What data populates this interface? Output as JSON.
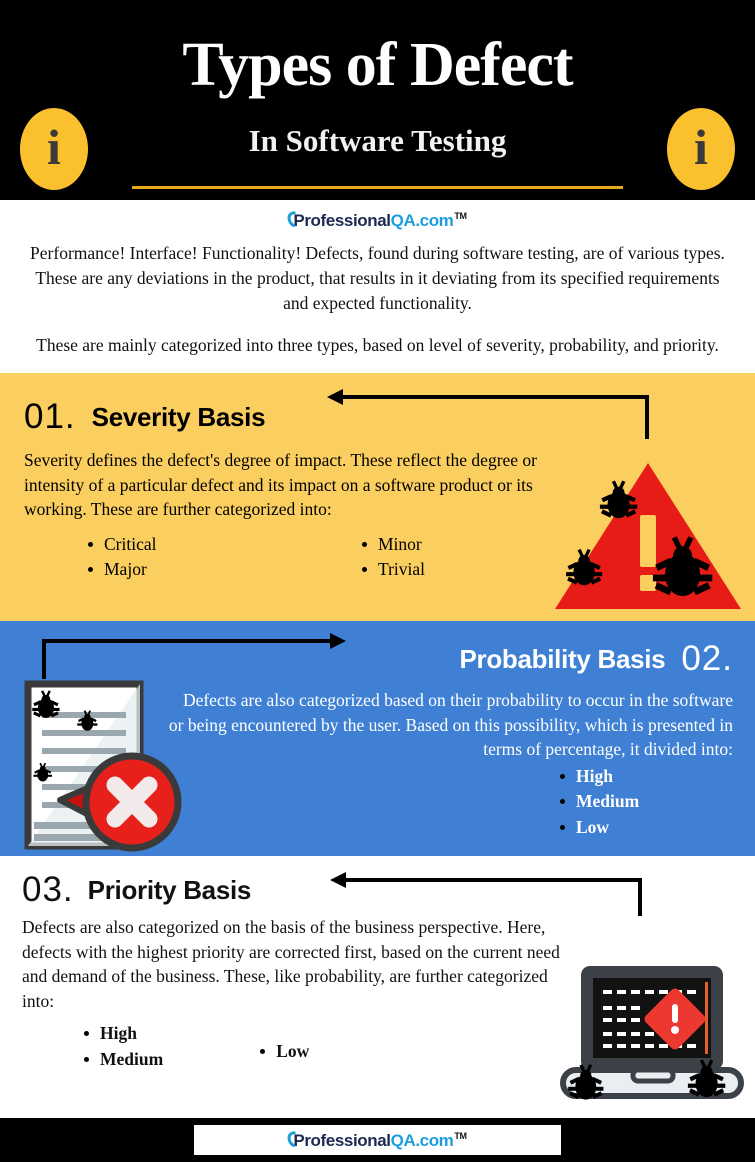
{
  "header": {
    "title": "Types of Defect",
    "subtitle": "In Software Testing",
    "info_icon_glyph": "i",
    "accent_color": "#FBC02D",
    "rule_color": "#E8A81C",
    "background": "#000000"
  },
  "brand": {
    "name_dark": "Professional",
    "name_light": "QA.com",
    "trademark": "TM",
    "dark_color": "#1b2a52",
    "light_color": "#1a9ede"
  },
  "intro": {
    "paragraph1": "Performance! Interface! Functionality! Defects, found during software testing, are of various types. These are any deviations in the product, that results in it deviating from its specified requirements and expected functionality.",
    "paragraph2": "These are mainly categorized into three types, based on level of severity, probability, and priority."
  },
  "sections": [
    {
      "number": "01.",
      "title": "Severity Basis",
      "body": "Severity defines the defect's degree of impact. These reflect the degree or intensity of a particular defect and its impact on a software product or its working. These are further categorized into:",
      "bullets_left": [
        "Critical",
        "Major"
      ],
      "bullets_right": [
        "Minor",
        "Trivial"
      ],
      "background": "#FBCE60",
      "text_color": "#000000",
      "icon": "warning-triangle-with-bugs",
      "icon_colors": {
        "triangle": "#E81C16",
        "mark": "#FBCE60",
        "bug": "#000000"
      }
    },
    {
      "number": "02.",
      "title": "Probability Basis",
      "body": "Defects are also categorized based on their probability to occur in the software or being encountered by the user. Based on this possibility, which is presented in terms of percentage, it divided into:",
      "bullets": [
        "High",
        "Medium",
        "Low"
      ],
      "background": "#3F80D4",
      "text_color": "#FFFFFF",
      "icon": "document-with-bugs-and-error-badge",
      "icon_colors": {
        "page": "#FFFFFF",
        "outline": "#3A3A3A",
        "badge": "#E8201C",
        "cross": "#F2EAEA"
      }
    },
    {
      "number": "03.",
      "title": "Priority Basis",
      "body": "Defects are also categorized on the basis of the business perspective. Here, defects with the highest priority are corrected first, based on the current need and demand of the business. These, like probability, are further categorized into:",
      "bullets_left": [
        "High",
        "Medium"
      ],
      "bullets_right": [
        "Low"
      ],
      "background": "#FFFFFF",
      "text_color": "#111111",
      "icon": "laptop-with-error-and-bugs",
      "icon_colors": {
        "body": "#3C4147",
        "screen": "#121212",
        "alert": "#ED3832",
        "base": "#E9EEF2"
      }
    }
  ],
  "footer": {
    "background": "#000000"
  }
}
